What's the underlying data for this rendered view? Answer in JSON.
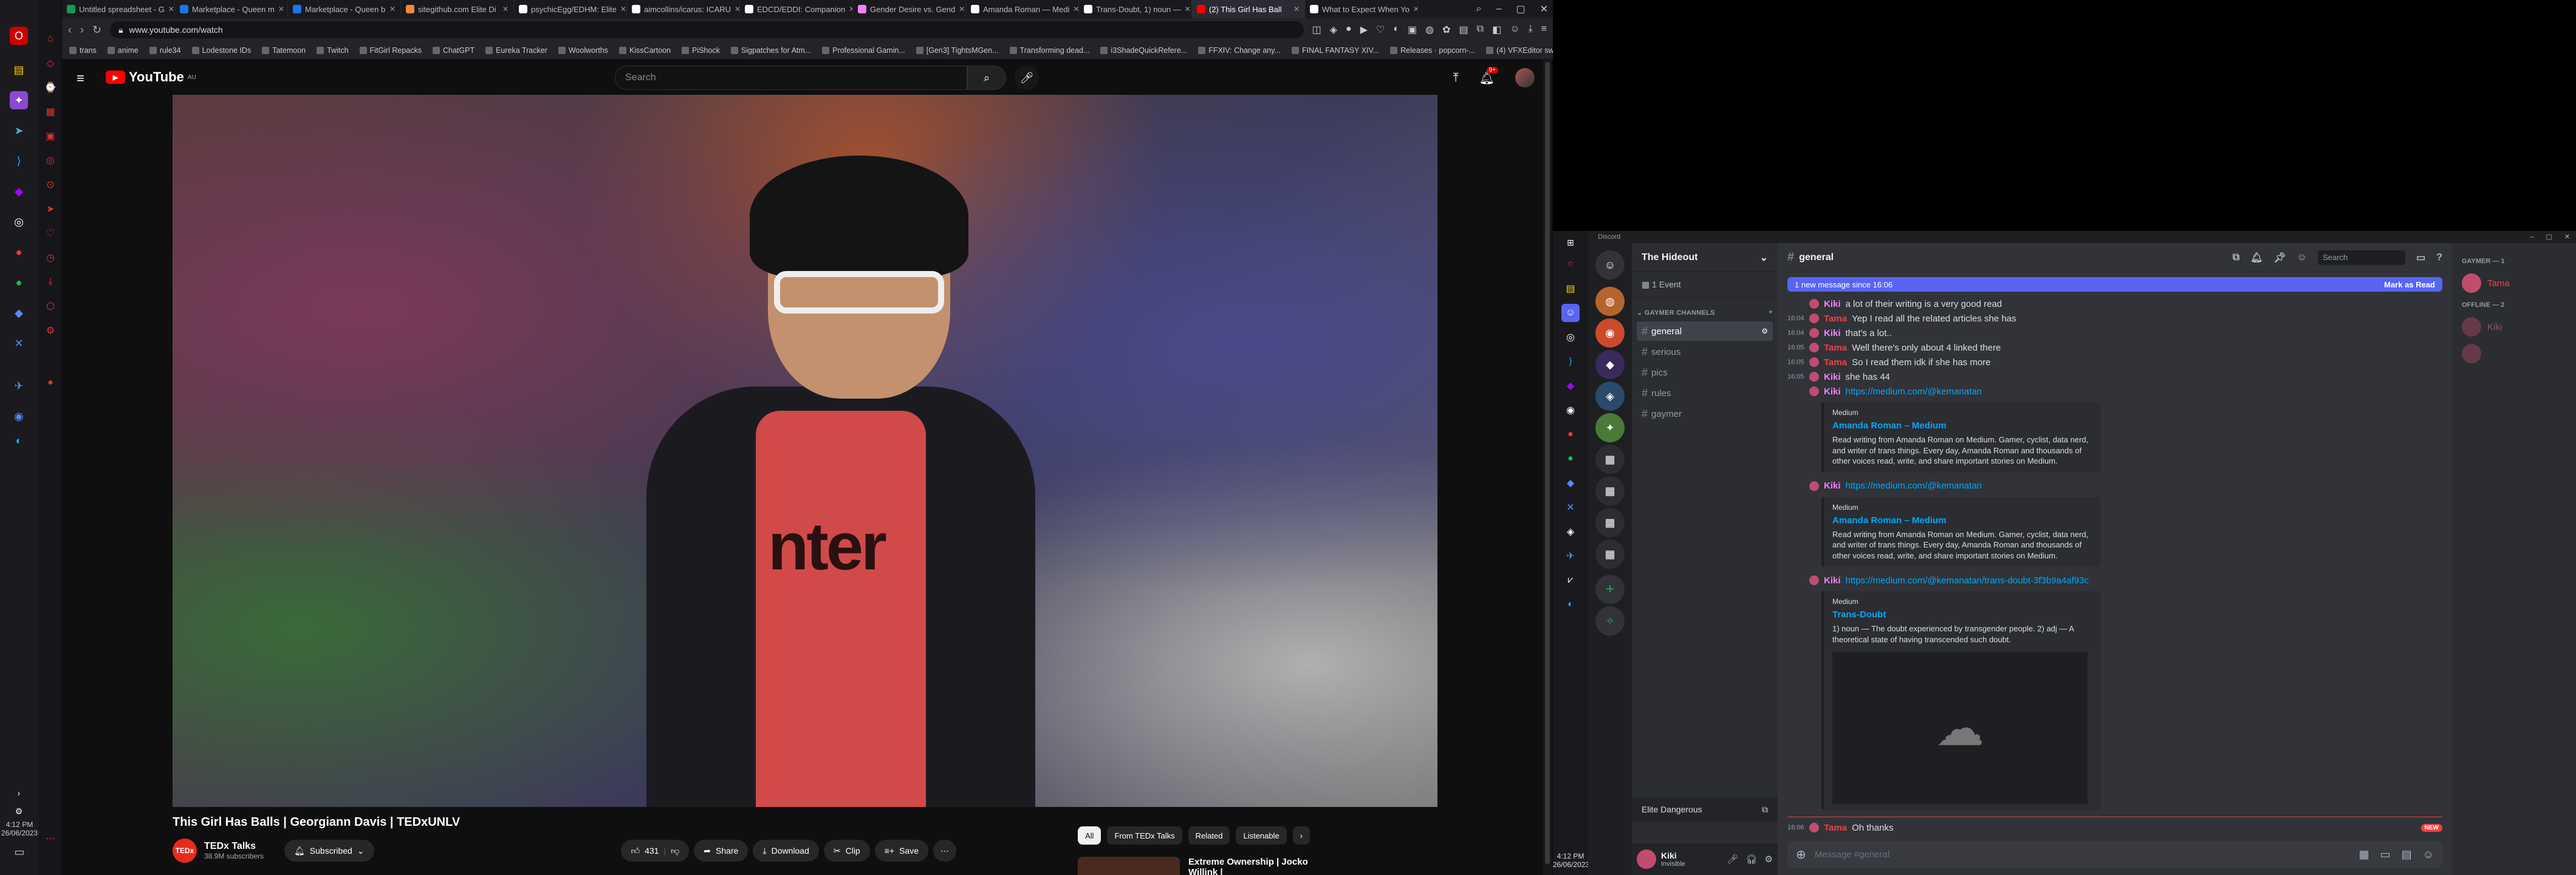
{
  "browser": {
    "tabs": [
      {
        "label": "Untitled spreadsheet - G",
        "color": "#0f9d58"
      },
      {
        "label": "Marketplace - Queen m",
        "color": "#1877f2"
      },
      {
        "label": "Marketplace - Queen b",
        "color": "#1877f2"
      },
      {
        "label": "sitegithub.com Elite Di",
        "color": "#f0883e"
      },
      {
        "label": "psychicEgg/EDHM: Elite",
        "color": "#ffffff"
      },
      {
        "label": "aimcollins/icarus: ICARU",
        "color": "#ffffff"
      },
      {
        "label": "EDCD/EDDI: Companion",
        "color": "#ffffff"
      },
      {
        "label": "Gender Desire vs. Gend",
        "color": "#f47fff"
      },
      {
        "label": "Amanda Roman — Medi",
        "color": "#ffffff"
      },
      {
        "label": "Trans-Doubt, 1) noun —",
        "color": "#ffffff"
      },
      {
        "label": "(2) This Girl Has Ball",
        "color": "#ff0000",
        "active": true
      },
      {
        "label": "What to Expect When Yo",
        "color": "#ffffff"
      }
    ],
    "url": "www.youtube.com/watch",
    "bookmarks": [
      "trans",
      "anime",
      "rule34",
      "Lodestone IDs",
      "Tatemoon",
      "Twitch",
      "FitGirl Repacks",
      "ChatGPT",
      "Eureka Tracker",
      "Woolworths",
      "KissCartoon",
      "PiShock",
      "Sigpatches for Atm...",
      "Professional Gamin...",
      "[Gen3] TightsMGen...",
      "Transforming dead...",
      "i3ShadeQuickRefere...",
      "FFXIV: Change any...",
      "FINAL FANTASY XIV...",
      "Releases · popcorn-...",
      "(4) VFXEditor swap..."
    ]
  },
  "youtube": {
    "logo": "YouTube",
    "logo_region": "AU",
    "search_placeholder": "Search",
    "notification_count": "9+",
    "video_title": "This Girl Has Balls | Georgiann Davis | TEDxUNLV",
    "video_shirt_text": "nter",
    "channel": {
      "name": "TEDx Talks",
      "subs": "38.9M subscribers",
      "avatar": "TEDx"
    },
    "subscribe_label": "Subscribed",
    "like_count": "431",
    "share_label": "Share",
    "download_label": "Download",
    "clip_label": "Clip",
    "save_label": "Save",
    "chips": [
      "All",
      "From TEDx Talks",
      "Related",
      "Listenable"
    ],
    "rec_title": "Extreme Ownership | Jocko Willink |"
  },
  "left_taskbar": {
    "time": "4:12 PM",
    "date": "26/06/2023"
  },
  "discord": {
    "window_title": "Discord",
    "server_name": "The Hideout",
    "event": "1 Event",
    "category": "GAYMER CHANNELS",
    "channels": [
      {
        "name": "general",
        "selected": true
      },
      {
        "name": "serious"
      },
      {
        "name": "pics"
      },
      {
        "name": "rules"
      },
      {
        "name": "gaymer"
      }
    ],
    "voice_label": "Elite Dangerous",
    "user": {
      "name": "Kiki",
      "status": "Invisible"
    },
    "current_channel": "general",
    "search_placeholder": "Search",
    "new_messages_bar": "1 new message since 16:06",
    "mark_as_read": "Mark as Read",
    "messages": [
      {
        "time": "",
        "author": "Kiki",
        "text": "a lot of their writing is a very good read"
      },
      {
        "time": "16:04",
        "author": "Tama",
        "text": "Yep I read all the related articles she has"
      },
      {
        "time": "16:04",
        "author": "Kiki",
        "text": "that's a lot.."
      },
      {
        "time": "16:05",
        "author": "Tama",
        "text": "Well there's only about 4 linked there"
      },
      {
        "time": "16:05",
        "author": "Tama",
        "text": "So I read them idk if she has more"
      },
      {
        "time": "16:05",
        "author": "Kiki",
        "text": "she has 44"
      }
    ],
    "embeds": [
      {
        "link": "https://medium.com/@kemanatan",
        "provider": "Medium",
        "title": "Amanda Roman – Medium",
        "desc": "Read writing from Amanda Roman on Medium. Gamer, cyclist, data nerd, and writer of trans things. Every day, Amanda Roman and thousands of other voices read, write, and share important stories on Medium."
      },
      {
        "link": "https://medium.com/@kemanatan",
        "provider": "Medium",
        "title": "Amanda Roman – Medium",
        "desc": "Read writing from Amanda Roman on Medium. Gamer, cyclist, data nerd, and writer of trans things. Every day, Amanda Roman and thousands of other voices read, write, and share important stories on Medium."
      },
      {
        "link": "https://medium.com/@kemanatan/trans-doubt-3f3b9a4af93c",
        "provider": "Medium",
        "title": "Trans-Doubt",
        "desc": "1) noun — The doubt experienced by transgender people. 2) adj — A theoretical state of having transcended such doubt."
      }
    ],
    "last_message": {
      "time": "16:06",
      "author": "Tama",
      "text": "Oh thanks",
      "badge": "NEW"
    },
    "input_placeholder": "Message #general",
    "member_groups": [
      {
        "label": "GAYMER — 1",
        "members": [
          "Tama"
        ]
      },
      {
        "label": "OFFLINE — 2",
        "members": [
          "Kiki",
          ""
        ]
      }
    ],
    "taskbar": {
      "time": "4:12 PM",
      "date": "26/06/2023"
    }
  }
}
